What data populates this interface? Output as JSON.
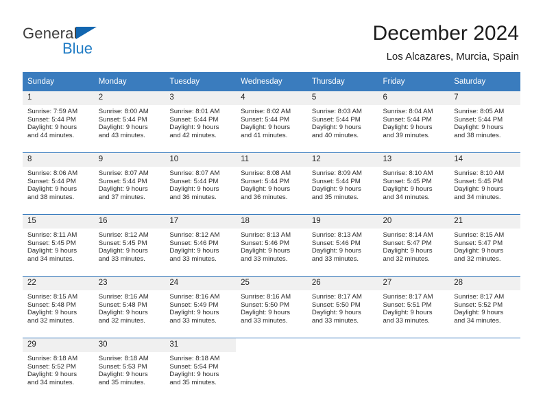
{
  "brand": {
    "name_part1": "General",
    "name_part2": "Blue",
    "triangle_color": "#1266b0",
    "blue_color": "#1f7bc4"
  },
  "header": {
    "title": "December 2024",
    "subtitle": "Los Alcazares, Murcia, Spain"
  },
  "theme": {
    "header_bg": "#3a7cbe",
    "header_text": "#ffffff",
    "daynum_band_bg": "#f0f0f0",
    "row_divider": "#3a7cbe",
    "body_text": "#2a2a2a"
  },
  "calendar": {
    "weekday_headers": [
      "Sunday",
      "Monday",
      "Tuesday",
      "Wednesday",
      "Thursday",
      "Friday",
      "Saturday"
    ],
    "weeks": [
      [
        {
          "day": "1",
          "sunrise": "Sunrise: 7:59 AM",
          "sunset": "Sunset: 5:44 PM",
          "daylight_line1": "Daylight: 9 hours",
          "daylight_line2": "and 44 minutes."
        },
        {
          "day": "2",
          "sunrise": "Sunrise: 8:00 AM",
          "sunset": "Sunset: 5:44 PM",
          "daylight_line1": "Daylight: 9 hours",
          "daylight_line2": "and 43 minutes."
        },
        {
          "day": "3",
          "sunrise": "Sunrise: 8:01 AM",
          "sunset": "Sunset: 5:44 PM",
          "daylight_line1": "Daylight: 9 hours",
          "daylight_line2": "and 42 minutes."
        },
        {
          "day": "4",
          "sunrise": "Sunrise: 8:02 AM",
          "sunset": "Sunset: 5:44 PM",
          "daylight_line1": "Daylight: 9 hours",
          "daylight_line2": "and 41 minutes."
        },
        {
          "day": "5",
          "sunrise": "Sunrise: 8:03 AM",
          "sunset": "Sunset: 5:44 PM",
          "daylight_line1": "Daylight: 9 hours",
          "daylight_line2": "and 40 minutes."
        },
        {
          "day": "6",
          "sunrise": "Sunrise: 8:04 AM",
          "sunset": "Sunset: 5:44 PM",
          "daylight_line1": "Daylight: 9 hours",
          "daylight_line2": "and 39 minutes."
        },
        {
          "day": "7",
          "sunrise": "Sunrise: 8:05 AM",
          "sunset": "Sunset: 5:44 PM",
          "daylight_line1": "Daylight: 9 hours",
          "daylight_line2": "and 38 minutes."
        }
      ],
      [
        {
          "day": "8",
          "sunrise": "Sunrise: 8:06 AM",
          "sunset": "Sunset: 5:44 PM",
          "daylight_line1": "Daylight: 9 hours",
          "daylight_line2": "and 38 minutes."
        },
        {
          "day": "9",
          "sunrise": "Sunrise: 8:07 AM",
          "sunset": "Sunset: 5:44 PM",
          "daylight_line1": "Daylight: 9 hours",
          "daylight_line2": "and 37 minutes."
        },
        {
          "day": "10",
          "sunrise": "Sunrise: 8:07 AM",
          "sunset": "Sunset: 5:44 PM",
          "daylight_line1": "Daylight: 9 hours",
          "daylight_line2": "and 36 minutes."
        },
        {
          "day": "11",
          "sunrise": "Sunrise: 8:08 AM",
          "sunset": "Sunset: 5:44 PM",
          "daylight_line1": "Daylight: 9 hours",
          "daylight_line2": "and 36 minutes."
        },
        {
          "day": "12",
          "sunrise": "Sunrise: 8:09 AM",
          "sunset": "Sunset: 5:44 PM",
          "daylight_line1": "Daylight: 9 hours",
          "daylight_line2": "and 35 minutes."
        },
        {
          "day": "13",
          "sunrise": "Sunrise: 8:10 AM",
          "sunset": "Sunset: 5:45 PM",
          "daylight_line1": "Daylight: 9 hours",
          "daylight_line2": "and 34 minutes."
        },
        {
          "day": "14",
          "sunrise": "Sunrise: 8:10 AM",
          "sunset": "Sunset: 5:45 PM",
          "daylight_line1": "Daylight: 9 hours",
          "daylight_line2": "and 34 minutes."
        }
      ],
      [
        {
          "day": "15",
          "sunrise": "Sunrise: 8:11 AM",
          "sunset": "Sunset: 5:45 PM",
          "daylight_line1": "Daylight: 9 hours",
          "daylight_line2": "and 34 minutes."
        },
        {
          "day": "16",
          "sunrise": "Sunrise: 8:12 AM",
          "sunset": "Sunset: 5:45 PM",
          "daylight_line1": "Daylight: 9 hours",
          "daylight_line2": "and 33 minutes."
        },
        {
          "day": "17",
          "sunrise": "Sunrise: 8:12 AM",
          "sunset": "Sunset: 5:46 PM",
          "daylight_line1": "Daylight: 9 hours",
          "daylight_line2": "and 33 minutes."
        },
        {
          "day": "18",
          "sunrise": "Sunrise: 8:13 AM",
          "sunset": "Sunset: 5:46 PM",
          "daylight_line1": "Daylight: 9 hours",
          "daylight_line2": "and 33 minutes."
        },
        {
          "day": "19",
          "sunrise": "Sunrise: 8:13 AM",
          "sunset": "Sunset: 5:46 PM",
          "daylight_line1": "Daylight: 9 hours",
          "daylight_line2": "and 33 minutes."
        },
        {
          "day": "20",
          "sunrise": "Sunrise: 8:14 AM",
          "sunset": "Sunset: 5:47 PM",
          "daylight_line1": "Daylight: 9 hours",
          "daylight_line2": "and 32 minutes."
        },
        {
          "day": "21",
          "sunrise": "Sunrise: 8:15 AM",
          "sunset": "Sunset: 5:47 PM",
          "daylight_line1": "Daylight: 9 hours",
          "daylight_line2": "and 32 minutes."
        }
      ],
      [
        {
          "day": "22",
          "sunrise": "Sunrise: 8:15 AM",
          "sunset": "Sunset: 5:48 PM",
          "daylight_line1": "Daylight: 9 hours",
          "daylight_line2": "and 32 minutes."
        },
        {
          "day": "23",
          "sunrise": "Sunrise: 8:16 AM",
          "sunset": "Sunset: 5:48 PM",
          "daylight_line1": "Daylight: 9 hours",
          "daylight_line2": "and 32 minutes."
        },
        {
          "day": "24",
          "sunrise": "Sunrise: 8:16 AM",
          "sunset": "Sunset: 5:49 PM",
          "daylight_line1": "Daylight: 9 hours",
          "daylight_line2": "and 33 minutes."
        },
        {
          "day": "25",
          "sunrise": "Sunrise: 8:16 AM",
          "sunset": "Sunset: 5:50 PM",
          "daylight_line1": "Daylight: 9 hours",
          "daylight_line2": "and 33 minutes."
        },
        {
          "day": "26",
          "sunrise": "Sunrise: 8:17 AM",
          "sunset": "Sunset: 5:50 PM",
          "daylight_line1": "Daylight: 9 hours",
          "daylight_line2": "and 33 minutes."
        },
        {
          "day": "27",
          "sunrise": "Sunrise: 8:17 AM",
          "sunset": "Sunset: 5:51 PM",
          "daylight_line1": "Daylight: 9 hours",
          "daylight_line2": "and 33 minutes."
        },
        {
          "day": "28",
          "sunrise": "Sunrise: 8:17 AM",
          "sunset": "Sunset: 5:52 PM",
          "daylight_line1": "Daylight: 9 hours",
          "daylight_line2": "and 34 minutes."
        }
      ],
      [
        {
          "day": "29",
          "sunrise": "Sunrise: 8:18 AM",
          "sunset": "Sunset: 5:52 PM",
          "daylight_line1": "Daylight: 9 hours",
          "daylight_line2": "and 34 minutes."
        },
        {
          "day": "30",
          "sunrise": "Sunrise: 8:18 AM",
          "sunset": "Sunset: 5:53 PM",
          "daylight_line1": "Daylight: 9 hours",
          "daylight_line2": "and 35 minutes."
        },
        {
          "day": "31",
          "sunrise": "Sunrise: 8:18 AM",
          "sunset": "Sunset: 5:54 PM",
          "daylight_line1": "Daylight: 9 hours",
          "daylight_line2": "and 35 minutes."
        },
        {
          "day": "",
          "sunrise": "",
          "sunset": "",
          "daylight_line1": "",
          "daylight_line2": ""
        },
        {
          "day": "",
          "sunrise": "",
          "sunset": "",
          "daylight_line1": "",
          "daylight_line2": ""
        },
        {
          "day": "",
          "sunrise": "",
          "sunset": "",
          "daylight_line1": "",
          "daylight_line2": ""
        },
        {
          "day": "",
          "sunrise": "",
          "sunset": "",
          "daylight_line1": "",
          "daylight_line2": ""
        }
      ]
    ]
  }
}
